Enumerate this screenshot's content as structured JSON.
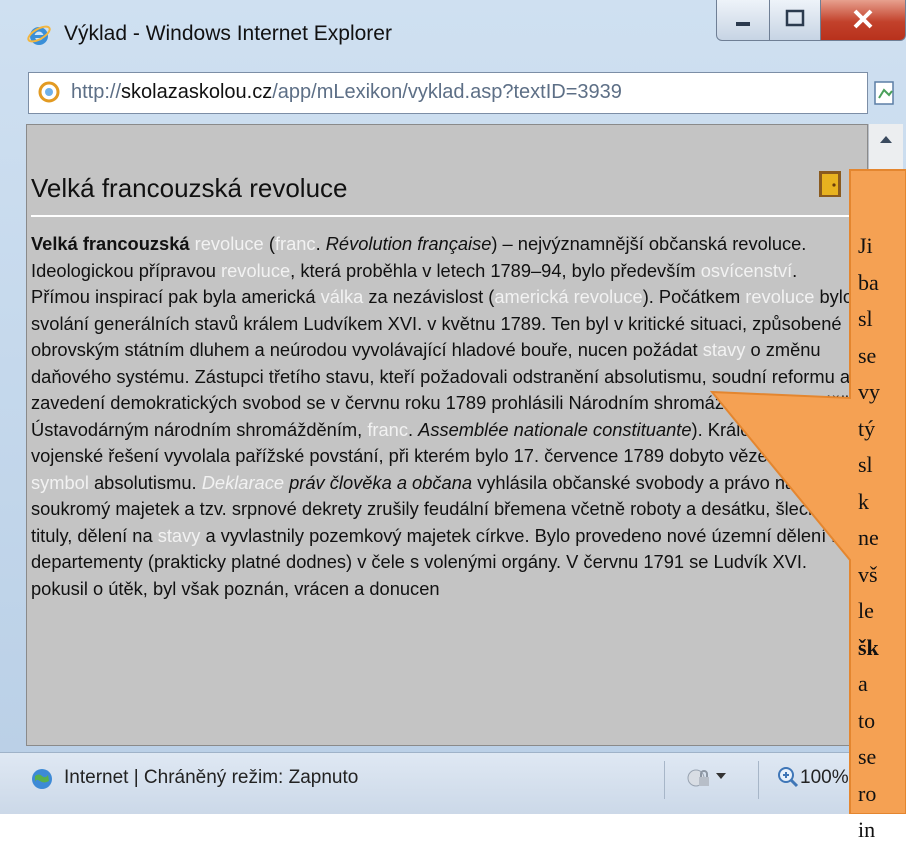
{
  "window": {
    "title": "Výklad - Windows Internet Explorer",
    "url_prefix": "http://",
    "url_domain": "skolazaskolou.cz",
    "url_path": "/app/mLexikon/vyklad.asp?textID=3939"
  },
  "article": {
    "heading": "Velká francouzská revoluce",
    "runs": [
      {
        "t": "Velká francouzská",
        "s": "b"
      },
      {
        "t": " "
      },
      {
        "t": "revoluce",
        "s": "l"
      },
      {
        "t": " ("
      },
      {
        "t": "franc",
        "s": "l"
      },
      {
        "t": ". "
      },
      {
        "t": "Révolution française",
        "s": "i"
      },
      {
        "t": ") – nejvýznamnější občanská revoluce. Ideologickou přípravou "
      },
      {
        "t": "revoluce",
        "s": "l"
      },
      {
        "t": ", která proběhla v letech 1789–94, bylo především "
      },
      {
        "t": "osvícenství",
        "s": "l"
      },
      {
        "t": ". Přímou inspirací pak byla americká "
      },
      {
        "t": "válka",
        "s": "l"
      },
      {
        "t": " za nezávislost ("
      },
      {
        "t": "americká revoluce",
        "s": "l"
      },
      {
        "t": "). Počátkem "
      },
      {
        "t": "revoluce",
        "s": "l"
      },
      {
        "t": " bylo svolání generálních stavů králem Ludvíkem XVI. v květnu 1789. Ten byl v kritické situaci, způsobené obrovským státním dluhem a neúrodou vyvolávající hladové bouře, nucen požádat "
      },
      {
        "t": "stavy",
        "s": "l"
      },
      {
        "t": " o změnu daňového systému. Zástupci třetího stavu, kteří požadovali odstranění absolutismu, soudní reformu a zavedení demokratických svobod se v červnu roku 1789 prohlásili Národním shromážděním, (později Ústavodárným národním shromážděním, "
      },
      {
        "t": "franc",
        "s": "l"
      },
      {
        "t": ". "
      },
      {
        "t": "Assemblée nationale constituante",
        "s": "i"
      },
      {
        "t": "). Králova snaha o vojenské řešení vyvolala pařížské povstání, při kterém bylo 17. července 1789 dobyto vězení Bastila, "
      },
      {
        "t": "symbol",
        "s": "l"
      },
      {
        "t": " absolutismu. "
      },
      {
        "t": "Deklarace",
        "s": "li"
      },
      {
        "t": " "
      },
      {
        "t": "práv člověka a občana",
        "s": "i"
      },
      {
        "t": " vyhlásila občanské svobody a právo na soukromý majetek a tzv. srpnové dekrety zrušily feudální břemena včetně roboty a desátku, šlechtické tituly, dělení na "
      },
      {
        "t": "stavy",
        "s": "l"
      },
      {
        "t": " a vyvlastnily pozemkový majetek církve. Bylo provedeno nové územní dělení na departementy (prakticky platné dodnes) v čele s volenými orgány. V červnu 1791 se Ludvík XVI. pokusil o útěk, byl však poznán, vrácen a donucen"
      }
    ]
  },
  "status": {
    "zone_text": "Internet | Chráněný režim: Zapnuto",
    "zoom": "100%"
  },
  "callout": {
    "lines": [
      {
        "t": "Ji",
        "b": false
      },
      {
        "t": "ba",
        "b": false
      },
      {
        "t": "sl",
        "b": false
      },
      {
        "t": "se",
        "b": false
      },
      {
        "t": "vy",
        "b": false
      },
      {
        "t": "tý",
        "b": false
      },
      {
        "t": "sl",
        "b": false
      },
      {
        "t": "k",
        "b": false
      },
      {
        "t": "ne",
        "b": false
      },
      {
        "t": "vš",
        "b": false
      },
      {
        "t": "le",
        "b": false
      },
      {
        "t": "šk",
        "b": true
      },
      {
        "t": "a",
        "b": false
      },
      {
        "t": "to",
        "b": false
      },
      {
        "t": "se",
        "b": false
      },
      {
        "t": "ro",
        "b": false
      },
      {
        "t": "in",
        "b": false
      }
    ],
    "fill": "#f5a153",
    "stroke": "#e4862f"
  }
}
